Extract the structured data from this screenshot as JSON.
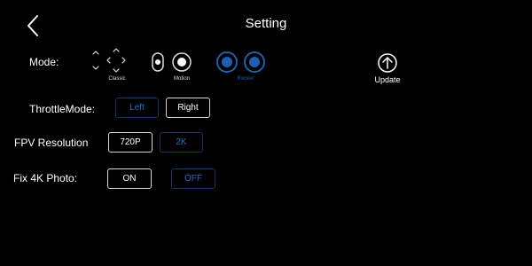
{
  "header": {
    "title": "Setting"
  },
  "labels": {
    "mode": "Mode:",
    "throttle_mode": "ThrottleMode:",
    "fpv_resolution": "FPV Resolution",
    "fix_4k_photo": "Fix 4K Photo:"
  },
  "mode": {
    "options": [
      {
        "label": "Classic",
        "icon": "dpad-arrows-icon"
      },
      {
        "label": "Motion",
        "icon": "toggle-dots-icon"
      },
      {
        "label": "Rocker",
        "icon": "joystick-circles-icon"
      }
    ],
    "selected": "Rocker",
    "active_color": "#1f5fae"
  },
  "update": {
    "label": "Update",
    "icon": "arrow-up-circle-icon"
  },
  "throttle_mode": {
    "options": [
      "Left",
      "Right"
    ],
    "selected": "Right"
  },
  "fpv_resolution": {
    "options": [
      "720P",
      "2K"
    ],
    "selected": "720P"
  },
  "fix_4k_photo": {
    "options": [
      "ON",
      "OFF"
    ],
    "selected": "ON"
  },
  "colors": {
    "background": "#000000",
    "accent_blue": "#1f5fae",
    "unselected_text": "#2d6bb8",
    "unselected_border": "#123a66",
    "selected_border": "#d8d8d8"
  }
}
